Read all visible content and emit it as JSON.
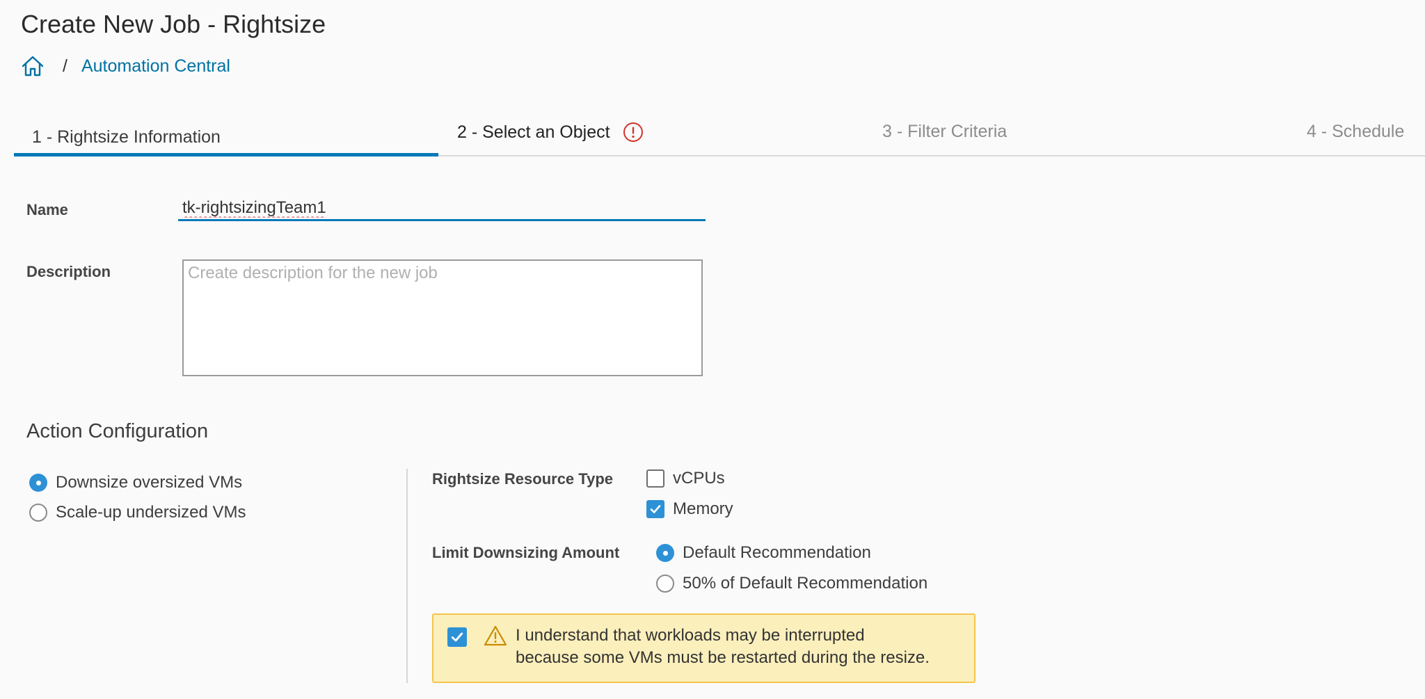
{
  "page": {
    "title": "Create New Job - Rightsize"
  },
  "breadcrumb": {
    "link": "Automation Central",
    "separator": "/"
  },
  "steps": [
    {
      "label": "1 - Rightsize Information",
      "state": "active"
    },
    {
      "label": "2 - Select an Object",
      "state": "error"
    },
    {
      "label": "3 - Filter Criteria",
      "state": "disabled"
    },
    {
      "label": "4 - Schedule",
      "state": "disabled"
    }
  ],
  "form": {
    "name_label": "Name",
    "name_value": "tk-rightsizingTeam1",
    "description_label": "Description",
    "description_placeholder": "Create description for the new job"
  },
  "action_config": {
    "title": "Action Configuration",
    "actions": [
      {
        "label": "Downsize oversized VMs",
        "selected": true
      },
      {
        "label": "Scale-up undersized VMs",
        "selected": false
      }
    ],
    "resource_type": {
      "label": "Rightsize Resource Type",
      "options": [
        {
          "label": "vCPUs",
          "checked": false
        },
        {
          "label": "Memory",
          "checked": true
        }
      ]
    },
    "limit": {
      "label": "Limit Downsizing Amount",
      "options": [
        {
          "label": "Default Recommendation",
          "selected": true
        },
        {
          "label": "50% of Default Recommendation",
          "selected": false
        }
      ]
    },
    "warning": {
      "line1": "I understand that workloads may be interrupted",
      "line2": "because some VMs must be restarted during the resize.",
      "checked": true
    }
  },
  "colors": {
    "accent": "#0079b8",
    "link": "#0072a3",
    "check": "#2d91d6",
    "error": "#d0352b",
    "warning_bg": "#fbefbc",
    "warning_border": "#f4c44d"
  }
}
